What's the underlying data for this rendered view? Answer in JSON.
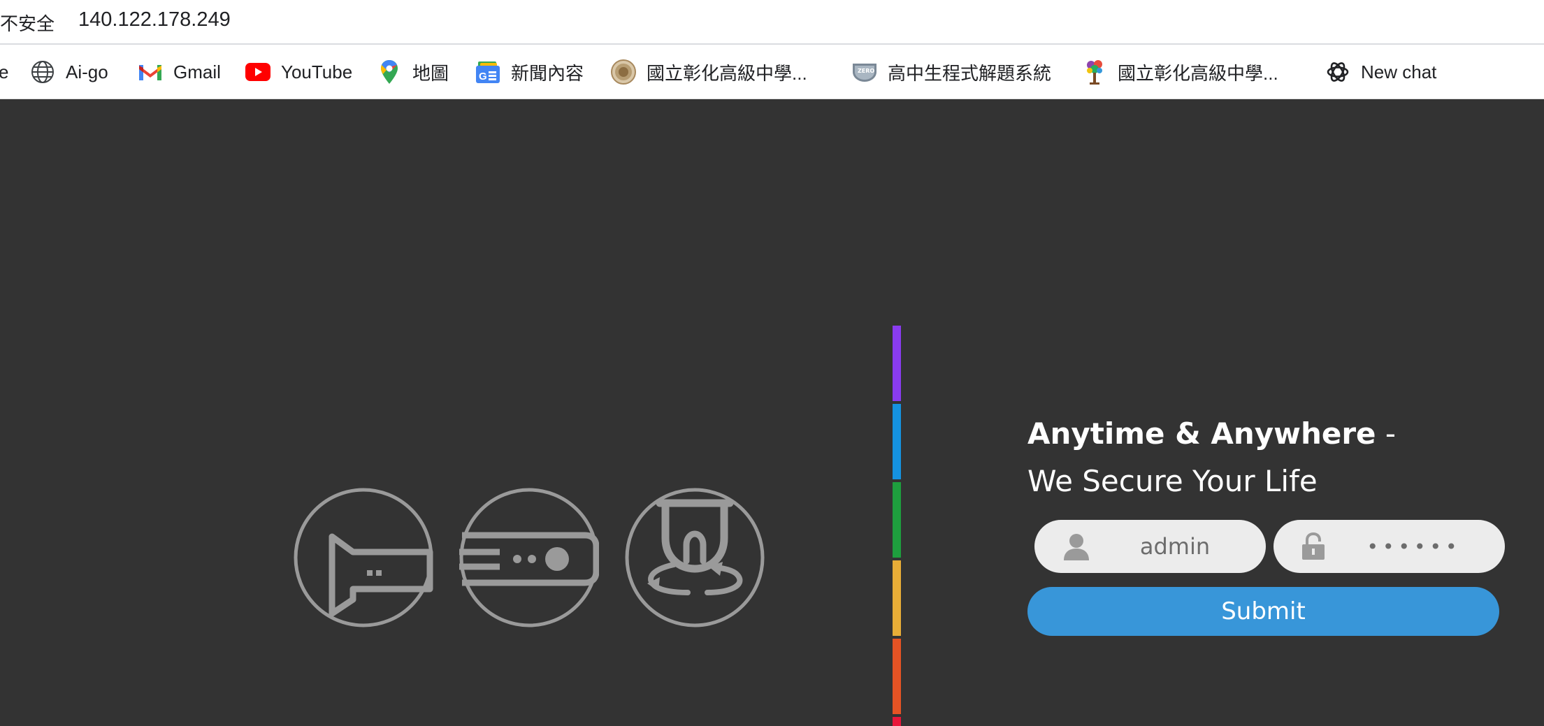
{
  "browser": {
    "security_label": "不安全",
    "url": "140.122.178.249"
  },
  "bookmarks": {
    "cut_off": "e",
    "items": [
      {
        "label": "Ai-go",
        "icon": "globe-icon"
      },
      {
        "label": "Gmail",
        "icon": "gmail-icon"
      },
      {
        "label": "YouTube",
        "icon": "youtube-icon"
      },
      {
        "label": "地圖",
        "icon": "maps-pin-icon"
      },
      {
        "label": "新聞內容",
        "icon": "google-news-icon"
      },
      {
        "label": "國立彰化高級中學...",
        "icon": "school-seal-icon"
      },
      {
        "label": "高中生程式解題系統",
        "icon": "zero-judge-icon"
      },
      {
        "label": "國立彰化高級中學...",
        "icon": "school-tree-icon"
      },
      {
        "label": "New chat",
        "icon": "chatgpt-icon"
      }
    ]
  },
  "hero": {
    "tagline_bold": "Anytime & Anywhere",
    "tagline_dash": " -",
    "tagline_line2": "We Secure Your Life",
    "feature_icons": [
      "camera-icon",
      "recorder-icon",
      "dome-camera-icon"
    ],
    "stripe_colors": [
      "#8a3cf0",
      "#1592e0",
      "#1e9e3e",
      "#e8ad37",
      "#e55324",
      "#e8163a"
    ]
  },
  "login": {
    "username_value": "admin",
    "password_value": "••••••",
    "submit_label": "Submit"
  },
  "colors": {
    "background": "#333333",
    "submit_button": "#3896d9",
    "field_background": "#ececec"
  }
}
